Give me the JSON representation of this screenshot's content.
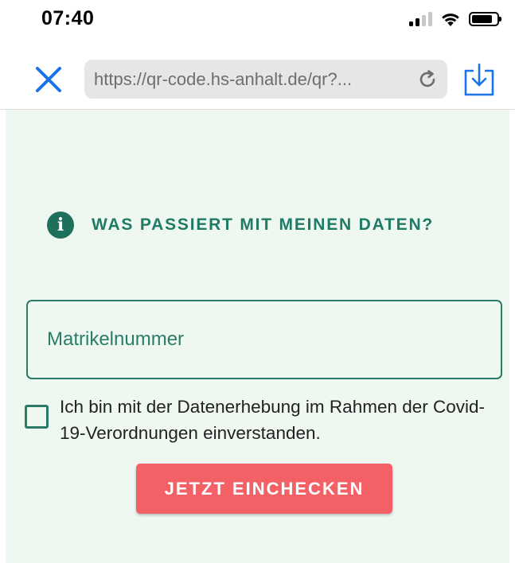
{
  "status_bar": {
    "time": "07:40",
    "signal_icon": "cellular-signal-icon",
    "wifi_icon": "wifi-icon",
    "battery_icon": "battery-icon",
    "battery_level": 0.82
  },
  "browser": {
    "close_icon": "close-icon",
    "url": "https://qr-code.hs-anhalt.de/qr?...",
    "reload_icon": "reload-icon",
    "download_icon": "download-icon",
    "accent_color": "#1a73e8"
  },
  "page": {
    "info_icon": "info-icon",
    "info_link": "WAS PASSIERT MIT MEINEN DATEN?",
    "matrikel_placeholder": "Matrikelnummer",
    "matrikel_value": "",
    "consent_checked": false,
    "consent_text": "Ich bin mit der Datenerhebung im Rahmen der Covid-19-Verordnungen einverstanden.",
    "checkin_button": "JETZT EINCHECKEN",
    "primary_color": "#1f7a66",
    "button_color": "#f36167",
    "background_color": "#eef8f1"
  }
}
